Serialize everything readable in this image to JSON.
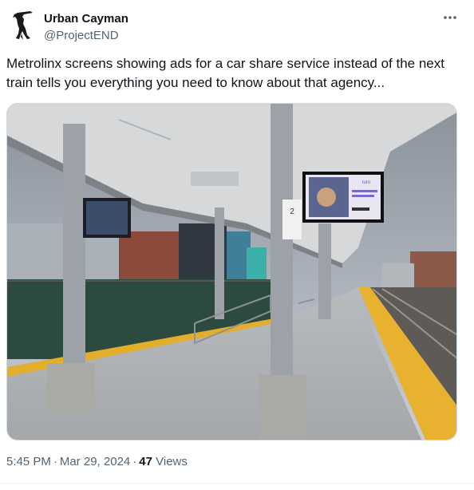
{
  "author": {
    "name": "Urban Cayman",
    "handle": "@ProjectEND",
    "avatar_icon": "alligator-silhouette-icon"
  },
  "more_icon": "more-options-icon",
  "tweet": {
    "text": "Metrolinx screens showing ads for a car share service instead of the next train tells you everything you need to know about that agency..."
  },
  "photo": {
    "ad_brand": "turo",
    "sign_label": "2"
  },
  "meta": {
    "time": "5:45 PM",
    "dot": "·",
    "date": "Mar 29, 2024",
    "dot2": "·",
    "views_count": "47",
    "views_label": "Views"
  },
  "colors": {
    "text_primary": "#0f1419",
    "text_secondary": "#536471",
    "border": "#cfd9de",
    "platform_tactile": "#e9b130"
  }
}
